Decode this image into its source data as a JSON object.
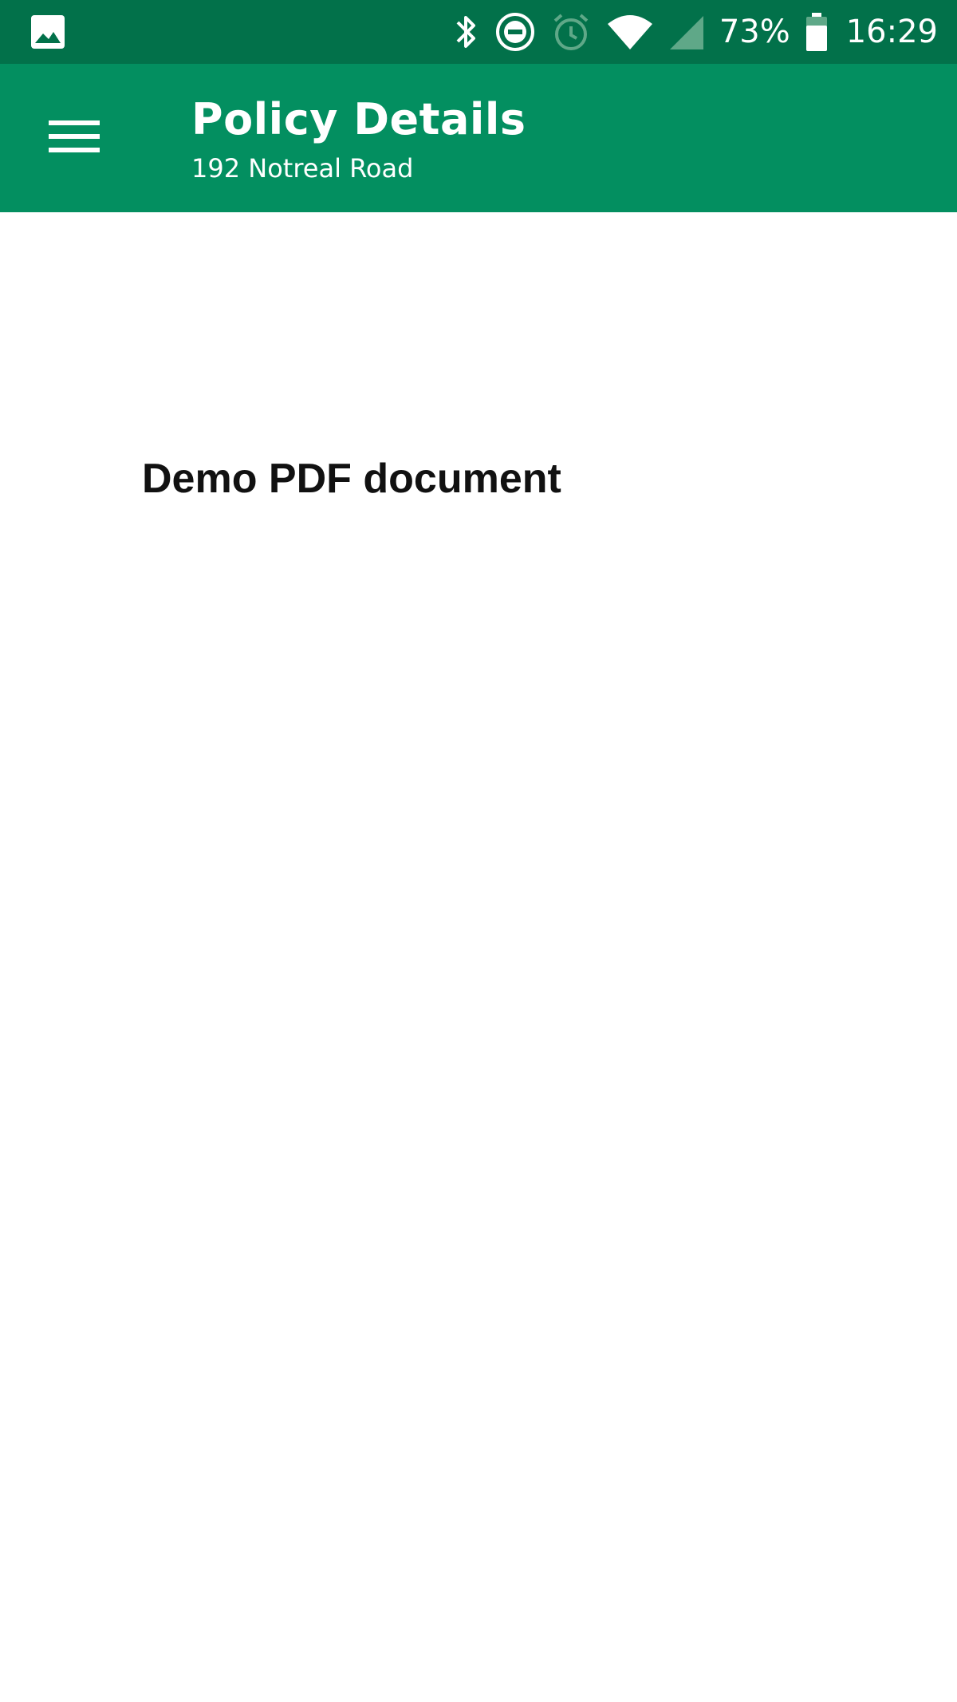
{
  "status_bar": {
    "icons_left": [
      "image-notification-icon"
    ],
    "icons_right": [
      "bluetooth-icon",
      "do-not-disturb-icon",
      "alarm-icon",
      "wifi-icon",
      "cell-signal-icon",
      "battery-icon"
    ],
    "battery_percent": "73%",
    "time": "16:29",
    "colors": {
      "background": "#02714a",
      "foreground": "#ffffff"
    }
  },
  "app_bar": {
    "title": "Policy Details",
    "subtitle": "192 Notreal Road",
    "colors": {
      "background": "#038f60",
      "foreground": "#ffffff"
    }
  },
  "document": {
    "heading": "Demo PDF document"
  }
}
